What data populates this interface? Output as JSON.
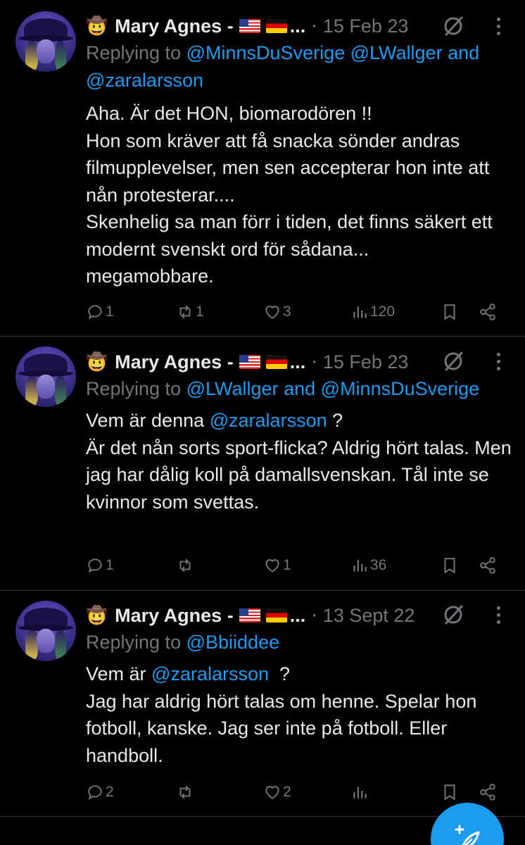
{
  "tweets": [
    {
      "author": "Mary Agnes -",
      "emoji": "🤠",
      "ellipsis": "...",
      "date": "15 Feb 23",
      "reply_prefix": "Replying to",
      "reply_mentions": [
        "@MinnsDuSverige",
        "@LWallger",
        "@zaralarsson"
      ],
      "reply_and": "and",
      "body": "Aha. Är det HON, biomarodören !!\nHon som kräver att få snacka sönder andras filmupplevelser, men sen accepterar hon inte att nån protesterar....\nSkenhelig sa man förr i tiden, det finns säkert ett modernt svenskt ord för sådana...\nmegamobbare.",
      "replies": "1",
      "retweets": "1",
      "likes": "3",
      "views": "120"
    },
    {
      "author": "Mary Agnes -",
      "emoji": "🤠",
      "ellipsis": "...",
      "date": "15 Feb 23",
      "reply_prefix": "Replying to",
      "reply_mentions": [
        "@LWallger",
        "@MinnsDuSverige"
      ],
      "reply_and": "and",
      "body_pre": "Vem är denna ",
      "body_mention": "@zaralarsson",
      "body_post": " ?\nÄr det nån sorts sport-flicka? Aldrig hört talas. Men jag har dålig koll på damallsvenskan. Tål inte se kvinnor som svettas.",
      "replies": "1",
      "retweets": "",
      "likes": "1",
      "views": "36"
    },
    {
      "author": "Mary Agnes -",
      "emoji": "🤠",
      "ellipsis": "...",
      "date": "13 Sept 22",
      "reply_prefix": "Replying to",
      "reply_mentions": [
        "@Bbiiddee"
      ],
      "body_pre": "Vem är ",
      "body_mention": "@zaralarsson",
      "body_post": "  ?\nJag har aldrig hört talas om henne. Spelar hon fotboll, kanske. Jag ser inte på fotboll. Eller handboll.",
      "replies": "2",
      "retweets": "",
      "likes": "2",
      "views": ""
    }
  ],
  "colors": {
    "background": "#000000",
    "text": "#e7e9ea",
    "muted": "#71767b",
    "accent": "#1d9bf0",
    "divider": "#2f3336"
  },
  "icons": [
    "grok-icon",
    "more-icon",
    "reply-icon",
    "retweet-icon",
    "like-icon",
    "views-icon",
    "bookmark-icon",
    "share-icon",
    "compose-icon"
  ]
}
